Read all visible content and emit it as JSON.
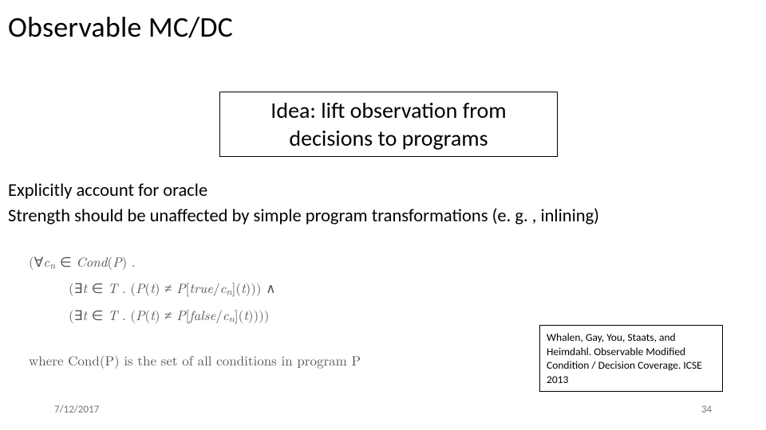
{
  "title": "Observable MC/DC",
  "idea": "Idea: lift observation from decisions to programs",
  "body": {
    "line1": "Explicitly account for oracle",
    "line2": "Strength should be unaffected by simple program transformations (e. g. , inlining)"
  },
  "math": {
    "l1_a": "(∀",
    "l1_b": " ∈ ",
    "l1_cond": "Cond",
    "l1_c": "(",
    "l1_P": "P",
    "l1_d": ")  .",
    "l2_a": "(∃",
    "l2_t": "t",
    "l2_b": " ∈ ",
    "l2_T": "T",
    "l2_c": "  .  (",
    "l2_P1": "P",
    "l2_d": "(",
    "l2_t2": "t",
    "l2_e": ") ≠ ",
    "l2_P2": "P",
    "l2_f": "[",
    "l2_true": "true",
    "l2_g": "/",
    "l2_h": "](",
    "l2_t3": "t",
    "l2_i": ")))   ∧",
    "l3_a": "(∃",
    "l3_t": "t",
    "l3_b": " ∈ ",
    "l3_T": "T",
    "l3_c": "  .  (",
    "l3_P1": "P",
    "l3_d": "(",
    "l3_t2": "t",
    "l3_e": ") ≠ ",
    "l3_P2": "P",
    "l3_f": "[",
    "l3_false": "false",
    "l3_g": "/",
    "l3_h": "](",
    "l3_t3": "t",
    "l3_i": "))))",
    "cn": "c",
    "n": "n"
  },
  "where": {
    "a": "where ",
    "cond": "Cond",
    "b": "(",
    "P": "P",
    "c": ") is the set of all conditions in program ",
    "P2": "P"
  },
  "citation": "Whalen, Gay, You, Staats, and Heimdahl. Observable Modified Condition / Decision Coverage. ICSE 2013",
  "footer": {
    "date": "7/12/2017",
    "page": "34"
  }
}
